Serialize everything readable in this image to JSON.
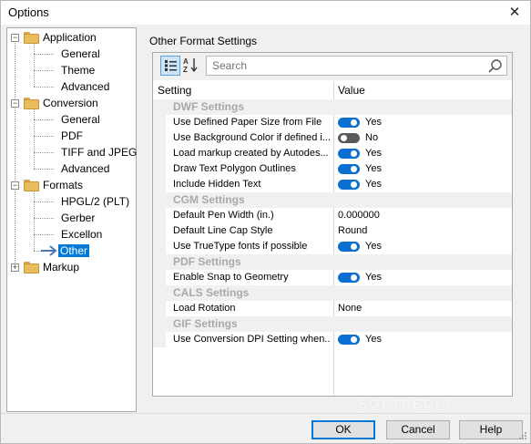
{
  "window": {
    "title": "Options",
    "close_glyph": "✕"
  },
  "tree": {
    "nodes": [
      {
        "label": "Application",
        "kind": "folder",
        "expander": "−"
      },
      {
        "label": "General",
        "kind": "leaf"
      },
      {
        "label": "Theme",
        "kind": "leaf"
      },
      {
        "label": "Advanced",
        "kind": "leaf"
      },
      {
        "label": "Conversion",
        "kind": "folder",
        "expander": "−"
      },
      {
        "label": "General",
        "kind": "leaf"
      },
      {
        "label": "PDF",
        "kind": "leaf"
      },
      {
        "label": "TIFF and JPEG",
        "kind": "leaf"
      },
      {
        "label": "Advanced",
        "kind": "leaf"
      },
      {
        "label": "Formats",
        "kind": "folder",
        "expander": "−"
      },
      {
        "label": "HPGL/2 (PLT)",
        "kind": "leaf"
      },
      {
        "label": "Gerber",
        "kind": "leaf"
      },
      {
        "label": "Excellon",
        "kind": "leaf"
      },
      {
        "label": "Other",
        "kind": "leaf",
        "selected": true
      },
      {
        "label": "Markup",
        "kind": "folder",
        "expander": "+"
      }
    ]
  },
  "panel": {
    "title": "Other Format Settings",
    "search_placeholder": "Search",
    "columns": {
      "setting": "Setting",
      "value": "Value"
    },
    "rows": [
      {
        "type": "group",
        "label": "DWF Settings"
      },
      {
        "type": "toggle",
        "name": "Use Defined Paper Size from File",
        "on": true,
        "text": "Yes"
      },
      {
        "type": "toggle",
        "name": "Use Background Color if defined i...",
        "on": false,
        "text": "No"
      },
      {
        "type": "toggle",
        "name": "Load markup created by Autodes...",
        "on": true,
        "text": "Yes"
      },
      {
        "type": "toggle",
        "name": "Draw Text Polygon Outlines",
        "on": true,
        "text": "Yes"
      },
      {
        "type": "toggle",
        "name": "Include Hidden Text",
        "on": true,
        "text": "Yes"
      },
      {
        "type": "group",
        "label": "CGM Settings"
      },
      {
        "type": "value",
        "name": "Default Pen Width (in.)",
        "value": "0.000000"
      },
      {
        "type": "value",
        "name": "Default Line Cap Style",
        "value": "Round"
      },
      {
        "type": "toggle",
        "name": "Use TrueType fonts if possible",
        "on": true,
        "text": "Yes"
      },
      {
        "type": "group",
        "label": "PDF Settings"
      },
      {
        "type": "toggle",
        "name": "Enable Snap to Geometry",
        "on": true,
        "text": "Yes"
      },
      {
        "type": "group",
        "label": "CALS Settings"
      },
      {
        "type": "value",
        "name": "Load Rotation",
        "value": "None"
      },
      {
        "type": "group",
        "label": "GIF Settings"
      },
      {
        "type": "toggle",
        "name": "Use Conversion DPI Setting when...",
        "on": true,
        "text": "Yes"
      }
    ]
  },
  "footer": {
    "ok_label": "OK",
    "cancel_label": "Cancel",
    "help_label": "Help"
  },
  "watermark": "SOFTPEDIA",
  "colors": {
    "accent": "#0078d7",
    "toggle_on": "#0a6fd0",
    "toggle_off": "#5a5a5a"
  },
  "icons": {
    "categorized": "categorized-view-icon",
    "alpha": "alphabetical-sort-icon",
    "search": "search-icon",
    "folder": "folder-icon",
    "selected_arrow": "arrow-right-icon"
  }
}
